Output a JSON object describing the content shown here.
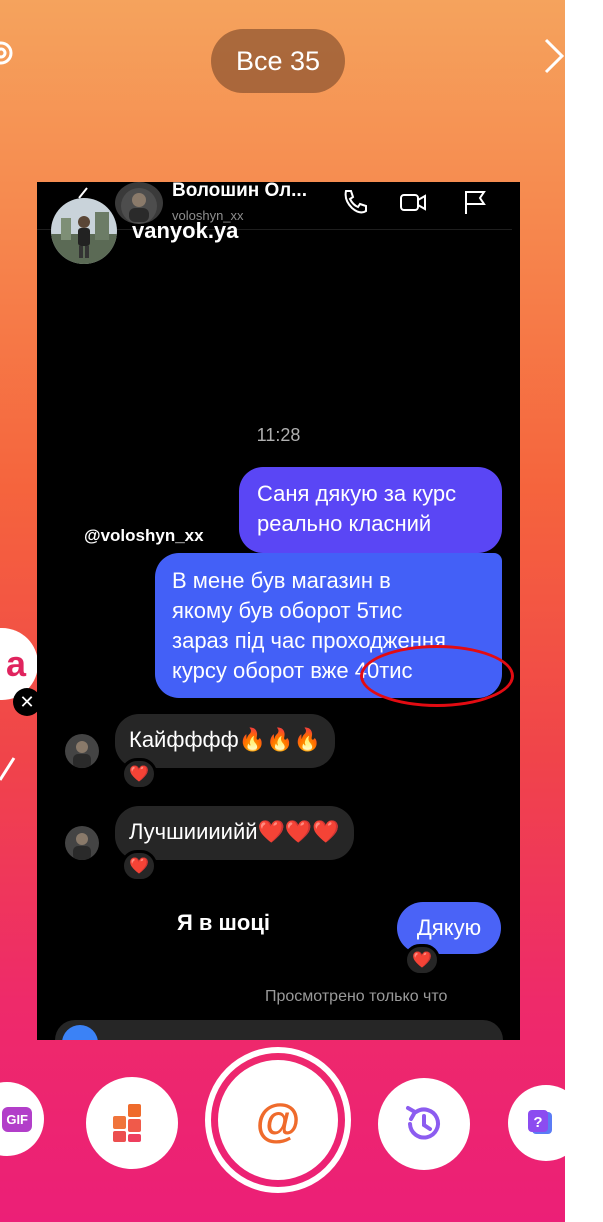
{
  "top": {
    "filter_label": "Все 35",
    "settings_icon": "gear-icon",
    "next_icon": "chevron-right-icon"
  },
  "side": {
    "letter": "a",
    "close_glyph": "✕"
  },
  "dm": {
    "contact_name": "Волошин Ол...",
    "contact_username": "voloshyn_xx",
    "icons": [
      "phone-icon",
      "video-icon",
      "flag-icon"
    ]
  },
  "story": {
    "username": "vanyok.ya",
    "mention_sticker": "@voloshyn_xx",
    "caption": "Я в шоці"
  },
  "chat": {
    "time": "11:28",
    "outgoing_1": [
      "Саня дякую за курс",
      "реально класний"
    ],
    "outgoing_2": [
      "В мене був магазин в",
      "якому був оборот 5тис",
      "зараз під час проходження",
      "курсу оборот вже 40тис"
    ],
    "incoming_1": "Кайфффф🔥🔥🔥",
    "incoming_2": "Лучшиииийй❤️❤️❤️",
    "outgoing_3": "Дякую",
    "seen": "Просмотрено только что",
    "reaction": "❤️"
  },
  "toolbar": {
    "gif_label": "GIF",
    "mention_symbol": "@"
  },
  "colors": {
    "bubble_purple": "#5a46f5",
    "bubble_blue": "#4360f7",
    "bubble_incoming": "#262626",
    "highlight_ring": "#e30b12"
  }
}
